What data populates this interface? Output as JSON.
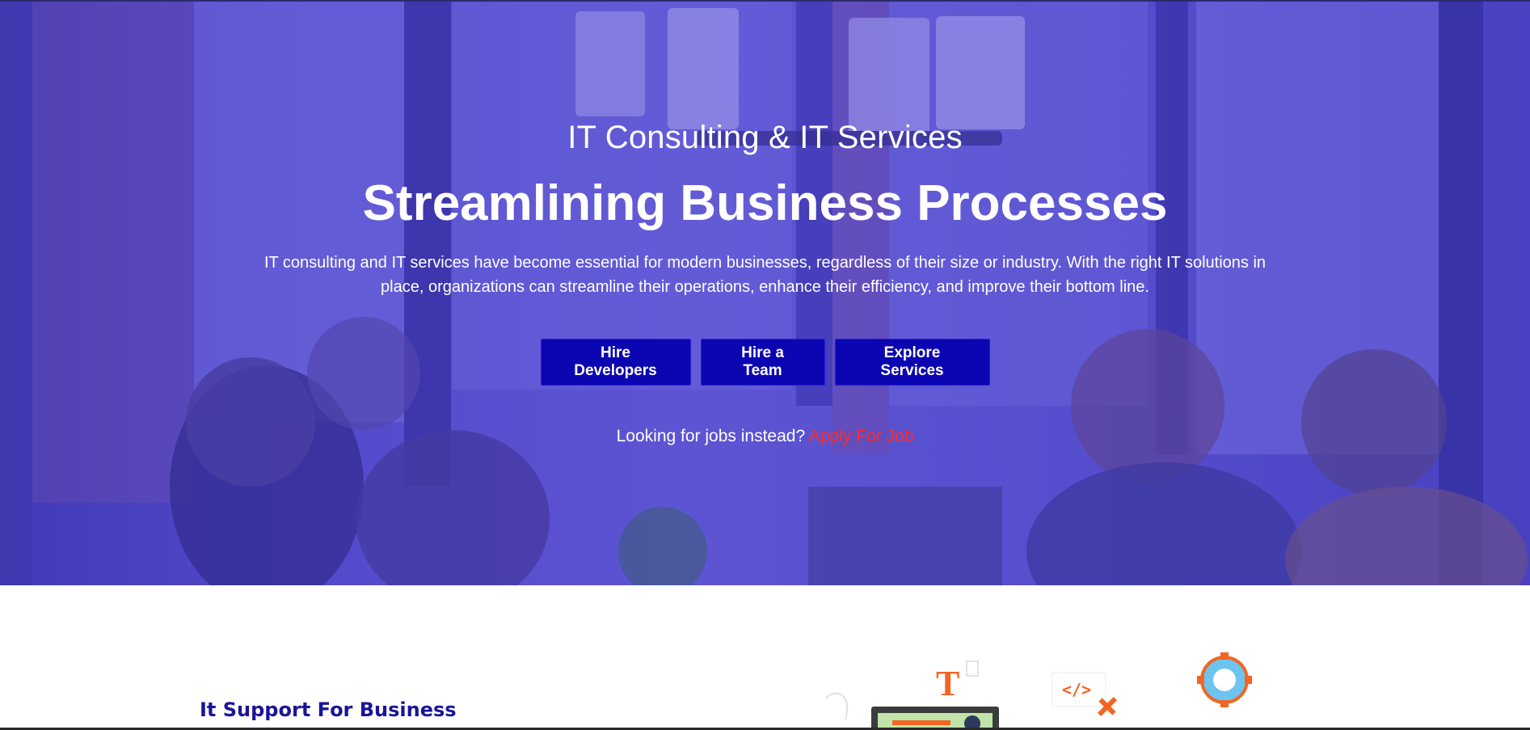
{
  "hero": {
    "eyebrow": "IT Consulting & IT Services",
    "headline": "Streamlining Business Processes",
    "lead": "IT consulting and IT services have become essential for modern businesses, regardless of their size or industry. With the right IT solutions in place, organizations can streamline their operations, enhance their efficiency, and improve their bottom line.",
    "buttons": {
      "hire_developers": "Hire Developers",
      "hire_team": "Hire a Team",
      "explore_services": "Explore Services"
    },
    "jobs_prompt": "Looking for jobs instead?",
    "jobs_link": "Apply For Job"
  },
  "section": {
    "title": "It Support For Business"
  },
  "illustration": {
    "letter_icon": "T",
    "code_icon": "</>"
  },
  "colors": {
    "overlay": "#5a52c8",
    "button": "#0c06b2",
    "link": "#ff2a2a",
    "section_title": "#1a1596",
    "accent_orange": "#f26522",
    "gear_blue": "#6cc4ef"
  }
}
